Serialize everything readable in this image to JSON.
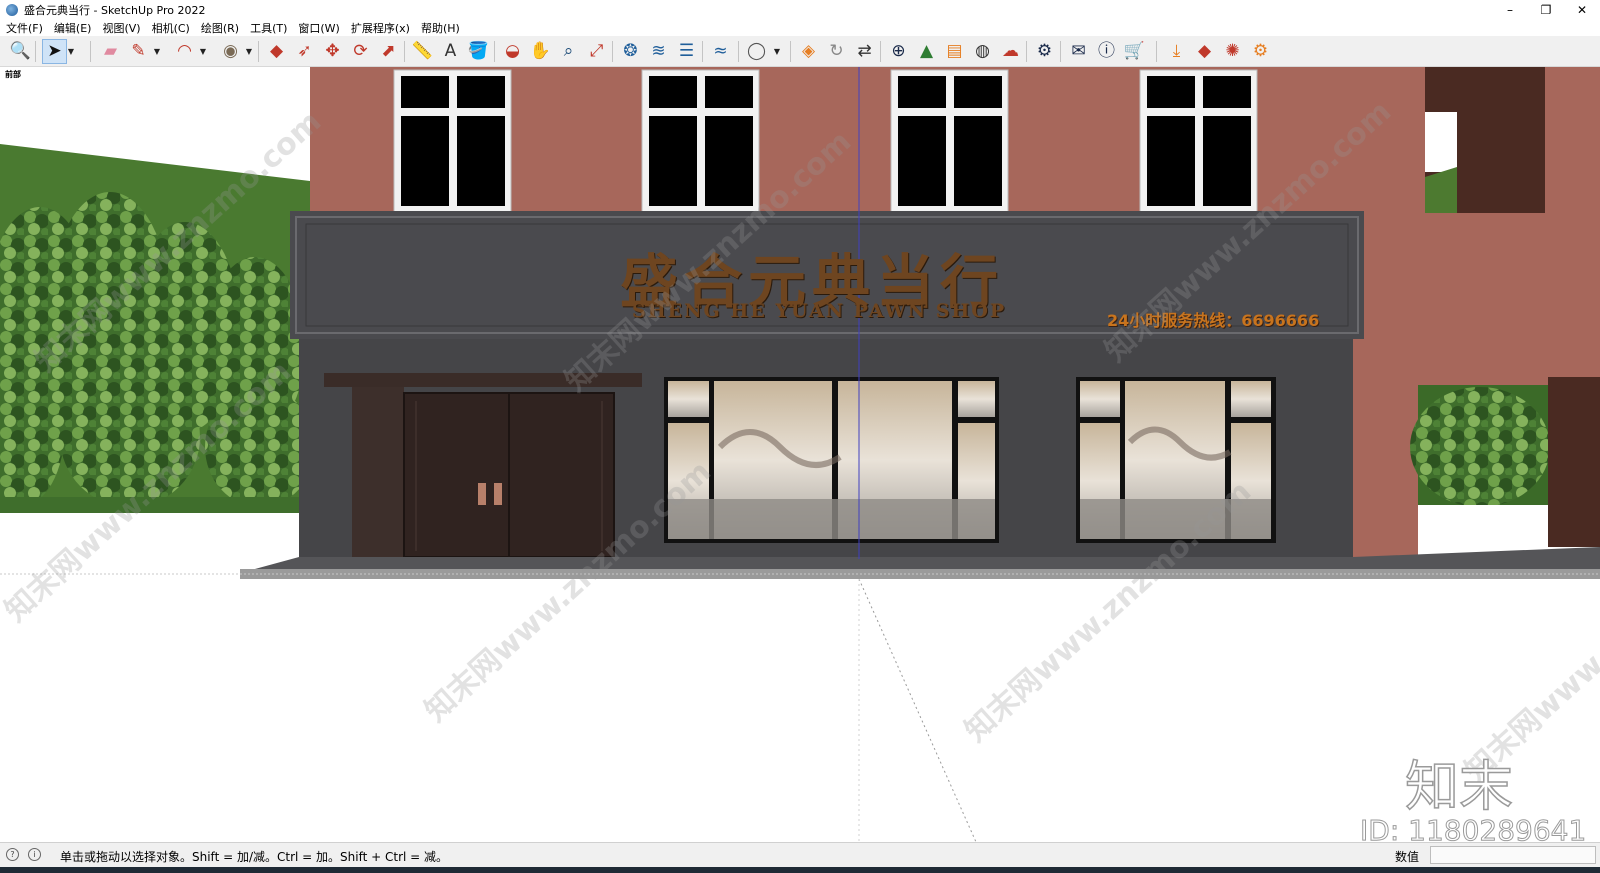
{
  "window": {
    "title": "盛合元典当行 - SketchUp Pro 2022",
    "minimize": "–",
    "restore": "❐",
    "close": "✕"
  },
  "menu": {
    "items": [
      "文件(F)",
      "编辑(E)",
      "视图(V)",
      "相机(C)",
      "绘图(R)",
      "工具(T)",
      "窗口(W)",
      "扩展程序(x)",
      "帮助(H)"
    ]
  },
  "toolbar": {
    "tools": [
      {
        "name": "zoom-window-icon",
        "glyph": "🔍",
        "color": "#333333"
      },
      {
        "name": "select-icon",
        "glyph": "➤",
        "color": "#111111",
        "selected": true
      },
      {
        "name": "eraser-icon",
        "glyph": "▰",
        "color": "#e08aa0"
      },
      {
        "name": "pencil-icon",
        "glyph": "✎",
        "color": "#c0392b"
      },
      {
        "name": "arc-icon",
        "glyph": "◠",
        "color": "#c0392b"
      },
      {
        "name": "shape-icon",
        "glyph": "◉",
        "color": "#7a6a55"
      },
      {
        "name": "push-pull-icon",
        "glyph": "◆",
        "color": "#c0392b"
      },
      {
        "name": "follow-me-icon",
        "glyph": "➶",
        "color": "#c0392b"
      },
      {
        "name": "move-icon",
        "glyph": "✥",
        "color": "#c0392b"
      },
      {
        "name": "rotate-icon",
        "glyph": "⟳",
        "color": "#c0392b"
      },
      {
        "name": "scale-icon",
        "glyph": "⬈",
        "color": "#c0392b"
      },
      {
        "name": "tape-measure-icon",
        "glyph": "📏",
        "color": "#b8860b"
      },
      {
        "name": "text-icon",
        "glyph": "A",
        "color": "#333333"
      },
      {
        "name": "paint-bucket-icon",
        "glyph": "🪣",
        "color": "#b8860b"
      },
      {
        "name": "orbit-icon",
        "glyph": "◒",
        "color": "#c0392b"
      },
      {
        "name": "pan-icon",
        "glyph": "✋",
        "color": "#c8a060"
      },
      {
        "name": "zoom-icon",
        "glyph": "⌕",
        "color": "#1f4e79"
      },
      {
        "name": "zoom-extents-icon",
        "glyph": "⤢",
        "color": "#c0392b"
      },
      {
        "name": "component-icon",
        "glyph": "❂",
        "color": "#1f5e9a"
      },
      {
        "name": "layers-icon",
        "glyph": "≋",
        "color": "#1f5e9a"
      },
      {
        "name": "stack-icon",
        "glyph": "☰",
        "color": "#1f5e9a"
      },
      {
        "name": "sandbox-icon",
        "glyph": "≈",
        "color": "#1f5e9a"
      },
      {
        "name": "user-icon",
        "glyph": "◯",
        "color": "#555555"
      },
      {
        "name": "extension-warehouse-icon",
        "glyph": "◈",
        "color": "#e67e22"
      },
      {
        "name": "refresh-icon",
        "glyph": "↻",
        "color": "#888888"
      },
      {
        "name": "scenes-icon",
        "glyph": "⇄",
        "color": "#333333"
      },
      {
        "name": "add-icon",
        "glyph": "⊕",
        "color": "#1a2a4a"
      },
      {
        "name": "tree-icon",
        "glyph": "▲",
        "color": "#2e7d32"
      },
      {
        "name": "bookshelf-icon",
        "glyph": "▤",
        "color": "#e67e22"
      },
      {
        "name": "checker-icon",
        "glyph": "◍",
        "color": "#333333"
      },
      {
        "name": "cloud-upload-icon",
        "glyph": "☁",
        "color": "#c0392b"
      },
      {
        "name": "gear-icon",
        "glyph": "⚙",
        "color": "#1a2a4a"
      },
      {
        "name": "mail-icon",
        "glyph": "✉",
        "color": "#1a2a4a"
      },
      {
        "name": "info-icon",
        "glyph": "ⓘ",
        "color": "#1a2a4a"
      },
      {
        "name": "cart-icon",
        "glyph": "🛒",
        "color": "#1a2a4a"
      },
      {
        "name": "download-icon",
        "glyph": "⤓",
        "color": "#e67e22"
      },
      {
        "name": "gem-icon",
        "glyph": "◆",
        "color": "#c0392b"
      },
      {
        "name": "flame-icon",
        "glyph": "✺",
        "color": "#c0392b"
      },
      {
        "name": "gear-orange-icon",
        "glyph": "⚙",
        "color": "#e67e22"
      }
    ]
  },
  "viewport": {
    "scene_label": "前部",
    "sign_cn": "盛合元典当行",
    "sign_en": "SHENG HE YUAN PAWN SHOP",
    "hotline": "24小时服务热线：6696666",
    "watermark_text": "知末网www.znzmo.com"
  },
  "status": {
    "hint": "单击或拖动以选择对象。Shift = 加/减。Ctrl = 加。Shift + Ctrl = 减。",
    "vcb_label": "数值",
    "vcb_value": ""
  },
  "branding": {
    "logo": "知末",
    "id": "ID: 1180289641"
  },
  "colors": {
    "wall": "#a7675b",
    "facade": "#46464a",
    "sign_text": "#6e4520",
    "accent": "#c8741e"
  }
}
